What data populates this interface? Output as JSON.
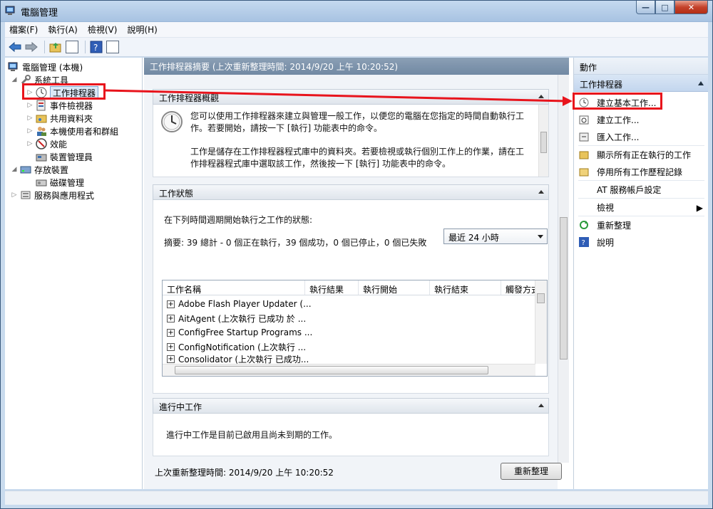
{
  "window": {
    "title": "電腦管理",
    "caption": {
      "minimize": "—",
      "maximize": "□",
      "close": "✕"
    }
  },
  "menu": [
    "檔案(F)",
    "執行(A)",
    "檢視(V)",
    "說明(H)"
  ],
  "tree": {
    "root": "電腦管理 (本機)",
    "system_tools": "系統工具",
    "task_scheduler": "工作排程器",
    "event_viewer": "事件檢視器",
    "shared_folders": "共用資料夾",
    "local_users": "本機使用者和群組",
    "performance": "效能",
    "device_manager": "裝置管理員",
    "storage": "存放裝置",
    "disk_management": "磁碟管理",
    "services_apps": "服務與應用程式"
  },
  "middle": {
    "header": "工作排程器摘要 (上次重新整理時間: 2014/9/20 上午 10:20:52)",
    "overview": {
      "title": "工作排程器概觀",
      "para1_line1": "您可以使用工作排程器來建立與管理一般工作，以便您的電腦在您指定的時間自動執行工",
      "para1_line2": "作。若要開始，請按一下 [執行] 功能表中的命令。",
      "para2_line1": "工作是儲存在工作排程器程式庫中的資料夾。若要檢視或執行個別工作上的作業，請在工",
      "para2_line2": "作排程器程式庫中選取該工作，然後按一下 [執行] 功能表中的命令。"
    },
    "status": {
      "title": "工作狀態",
      "prompt": "在下列時間週期開始執行之工作的狀態:",
      "period": "最近 24 小時",
      "summary": "摘要: 39 總計 - 0 個正在執行，39 個成功，0 個已停止，0 個已失敗",
      "columns": [
        "工作名稱",
        "執行結果",
        "執行開始",
        "執行結束",
        "觸發方式"
      ],
      "rows": [
        "Adobe Flash Player Updater (...",
        "AitAgent (上次執行 已成功 於 ...",
        "ConfigFree Startup Programs ...",
        "ConfigNotification (上次執行 ...",
        "Consolidator (上次執行 已成功..."
      ]
    },
    "active": {
      "title": "進行中工作",
      "text": "進行中工作是目前已啟用且尚未到期的工作。"
    },
    "last_refresh": "上次重新整理時間: 2014/9/20 上午 10:20:52",
    "refresh_button": "重新整理"
  },
  "actions": {
    "header": "動作",
    "section": "工作排程器",
    "items": [
      {
        "label": "建立基本工作..."
      },
      {
        "label": "建立工作..."
      },
      {
        "label": "匯入工作..."
      },
      {
        "label": "顯示所有正在執行的工作"
      },
      {
        "label": "停用所有工作歷程記錄"
      },
      {
        "label": "AT 服務帳戶設定"
      },
      {
        "label": "檢視"
      },
      {
        "label": "重新整理"
      },
      {
        "label": "說明"
      }
    ]
  },
  "colors": {
    "highlight": "#e8141c",
    "header": "#7189a3"
  }
}
